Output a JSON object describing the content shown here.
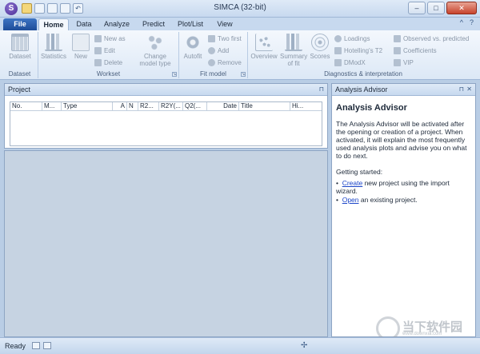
{
  "window": {
    "title": "SIMCA (32-bit)",
    "min_label": "–",
    "max_label": "□",
    "close_label": "✕"
  },
  "tabs": {
    "file": "File",
    "items": [
      "Home",
      "Data",
      "Analyze",
      "Predict",
      "Plot/List",
      "View"
    ],
    "active": "Home",
    "help_caret": "^",
    "help_icon": "?"
  },
  "ribbon": {
    "dataset": {
      "button": "Dataset",
      "group": "Dataset"
    },
    "workset": {
      "statistics": "Statistics",
      "new": "New",
      "new_as": "New as",
      "edit": "Edit",
      "delete": "Delete",
      "change_model_type": "Change model type",
      "group": "Workset"
    },
    "fit_model": {
      "autofit": "Autofit",
      "two_first": "Two first",
      "add": "Add",
      "remove": "Remove",
      "group": "Fit model"
    },
    "diagnostics": {
      "overview": "Overview",
      "summary_of_fit": "Summary of fit",
      "scores": "Scores",
      "loadings": "Loadings",
      "hotellings": "Hotelling's T2",
      "dmodx": "DModX",
      "observed_vs_predicted": "Observed vs. predicted",
      "coefficients": "Coefficients",
      "vip": "VIP",
      "group": "Diagnostics & interpretation"
    }
  },
  "project_panel": {
    "title": "Project",
    "pin": "⊓",
    "columns": [
      "No.",
      "M...",
      "Type",
      "A",
      "N",
      "R2...",
      "R2Y(...",
      "Q2(...",
      "Date",
      "Title",
      "Hi..."
    ]
  },
  "advisor_panel": {
    "title": "Analysis Advisor",
    "heading": "Analysis Advisor",
    "intro": "The Analysis Advisor will be activated after the opening or creation of a project. When activated, it will explain the most frequently used analysis plots and advise you on what to do next.",
    "getting_started": "Getting started:",
    "items": [
      {
        "link": "Create",
        "rest": " new project using the import wizard."
      },
      {
        "link": "Open",
        "rest": " an existing project."
      }
    ]
  },
  "status": {
    "text": "Ready"
  },
  "watermark": {
    "text": "当下软件园",
    "sub": "www.downxia.com"
  }
}
